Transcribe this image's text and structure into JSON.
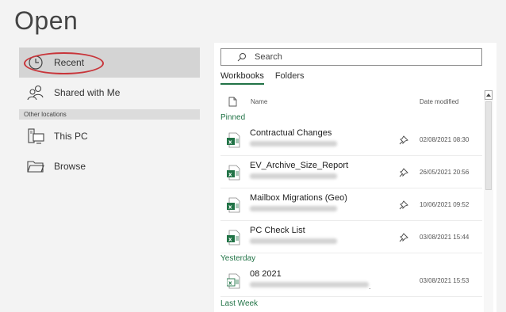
{
  "title": "Open",
  "nav": {
    "items": [
      {
        "label": "Recent",
        "icon": "clock-icon"
      },
      {
        "label": "Shared with Me",
        "icon": "people-icon"
      }
    ],
    "section_header": "Other locations",
    "other_items": [
      {
        "label": "This PC",
        "icon": "computer-icon"
      },
      {
        "label": "Browse",
        "icon": "folder-icon"
      }
    ]
  },
  "search": {
    "placeholder": "Search"
  },
  "tabs": [
    {
      "label": "Workbooks",
      "active": true
    },
    {
      "label": "Folders",
      "active": false
    }
  ],
  "columns": {
    "name": "Name",
    "date": "Date modified"
  },
  "groups": {
    "pinned": {
      "label": "Pinned",
      "files": [
        {
          "name": "Contractual Changes",
          "date": "02/08/2021 08:30"
        },
        {
          "name": "EV_Archive_Size_Report",
          "date": "26/05/2021 20:56"
        },
        {
          "name": "Mailbox Migrations (Geo)",
          "date": "10/06/2021 09:52"
        },
        {
          "name": "PC Check List",
          "date": "03/08/2021 15:44"
        }
      ]
    },
    "yesterday": {
      "label": "Yesterday",
      "files": [
        {
          "name": "08 2021",
          "date": "03/08/2021 15:53"
        }
      ]
    },
    "last_week": {
      "label": "Last Week"
    }
  },
  "colors": {
    "accent": "#217346",
    "highlight_ring": "#c8353a",
    "selected_bg": "#d4d4d4"
  }
}
